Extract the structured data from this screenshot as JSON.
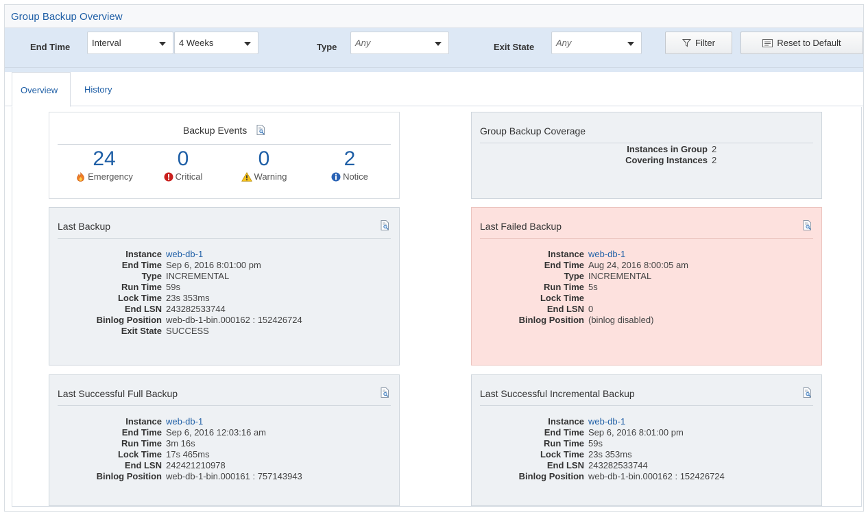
{
  "title": "Group Backup Overview",
  "filters": {
    "end_time_label": "End Time",
    "interval_value": "Interval",
    "weeks_value": "4 Weeks",
    "type_label": "Type",
    "type_value": "Any",
    "exit_state_label": "Exit State",
    "exit_state_value": "Any",
    "filter_button": "Filter",
    "reset_button": "Reset to Default"
  },
  "tabs": [
    {
      "label": "Overview",
      "active": true
    },
    {
      "label": "History",
      "active": false
    }
  ],
  "backup_events": {
    "title": "Backup Events",
    "items": [
      {
        "count": "24",
        "label": "Emergency"
      },
      {
        "count": "0",
        "label": "Critical"
      },
      {
        "count": "0",
        "label": "Warning"
      },
      {
        "count": "2",
        "label": "Notice"
      }
    ]
  },
  "coverage": {
    "title": "Group Backup Coverage",
    "rows": [
      {
        "key": "Instances in Group",
        "value": "2"
      },
      {
        "key": "Covering Instances",
        "value": "2"
      }
    ]
  },
  "last_backup": {
    "title": "Last Backup",
    "rows": [
      {
        "key": "Instance",
        "value": "web-db-1"
      },
      {
        "key": "End Time",
        "value": "Sep 6, 2016 8:01:00 pm"
      },
      {
        "key": "Type",
        "value": "INCREMENTAL"
      },
      {
        "key": "Run Time",
        "value": "59s"
      },
      {
        "key": "Lock Time",
        "value": "23s 353ms"
      },
      {
        "key": "End LSN",
        "value": "243282533744"
      },
      {
        "key": "Binlog Position",
        "value": "web-db-1-bin.000162 : 152426724"
      },
      {
        "key": "Exit State",
        "value": "SUCCESS"
      }
    ]
  },
  "last_failed_backup": {
    "title": "Last Failed Backup",
    "rows": [
      {
        "key": "Instance",
        "value": "web-db-1"
      },
      {
        "key": "End Time",
        "value": "Aug 24, 2016 8:00:05 am"
      },
      {
        "key": "Type",
        "value": "INCREMENTAL"
      },
      {
        "key": "Run Time",
        "value": "5s"
      },
      {
        "key": "Lock Time",
        "value": ""
      },
      {
        "key": "End LSN",
        "value": "0"
      },
      {
        "key": "Binlog Position",
        "value": "(binlog disabled)"
      }
    ]
  },
  "last_full_backup": {
    "title": "Last Successful Full Backup",
    "rows": [
      {
        "key": "Instance",
        "value": "web-db-1"
      },
      {
        "key": "End Time",
        "value": "Sep 6, 2016 12:03:16 am"
      },
      {
        "key": "Run Time",
        "value": "3m 16s"
      },
      {
        "key": "Lock Time",
        "value": "17s 465ms"
      },
      {
        "key": "End LSN",
        "value": "242421210978"
      },
      {
        "key": "Binlog Position",
        "value": "web-db-1-bin.000161 : 757143943"
      }
    ]
  },
  "last_incremental_backup": {
    "title": "Last Successful Incremental Backup",
    "rows": [
      {
        "key": "Instance",
        "value": "web-db-1"
      },
      {
        "key": "End Time",
        "value": "Sep 6, 2016 8:01:00 pm"
      },
      {
        "key": "Run Time",
        "value": "59s"
      },
      {
        "key": "Lock Time",
        "value": "23s 353ms"
      },
      {
        "key": "End LSN",
        "value": "243282533744"
      },
      {
        "key": "Binlog Position",
        "value": "web-db-1-bin.000162 : 152426724"
      }
    ]
  },
  "colors": {
    "accent": "#1f5fa6",
    "filter_bar": "#dde8f5",
    "panel": "#eef1f4",
    "failed_panel": "#fde1de"
  },
  "icons": {
    "details": "magnifier-document-icon",
    "emergency": "fire-icon",
    "critical": "exclamation-circle-icon",
    "warning": "warning-triangle-icon",
    "notice": "info-circle-icon"
  }
}
